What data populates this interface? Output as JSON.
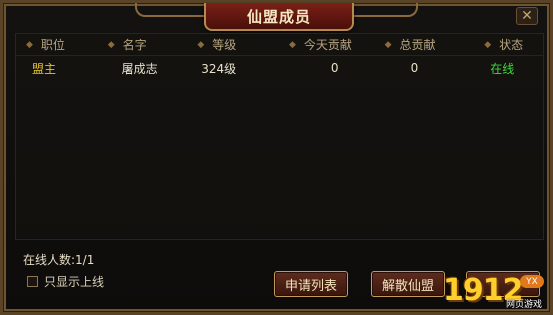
{
  "window": {
    "title": "仙盟成员"
  },
  "table": {
    "headers": [
      "职位",
      "名字",
      "等级",
      "今天贡献",
      "总贡献",
      "状态"
    ],
    "rows": [
      {
        "rank": "盟主",
        "name": "屠成志",
        "level": "324级",
        "today": "0",
        "total": "0",
        "status": "在线"
      }
    ]
  },
  "footer": {
    "online_count": "在线人数:1/1",
    "only_online_label": "只显示上线",
    "apply_list_label": "申请列表",
    "disband_label": "解散仙盟"
  },
  "logo": {
    "digits": "1912",
    "badge": "YX",
    "sub": "网页游戏"
  },
  "colors": {
    "rank": "#e6c232",
    "status_online": "#3ed93e",
    "title_plate": "#7a2017",
    "frame": "#5a4428"
  },
  "icons": {
    "close": "close-icon",
    "header_marker": "diamond-icon"
  }
}
